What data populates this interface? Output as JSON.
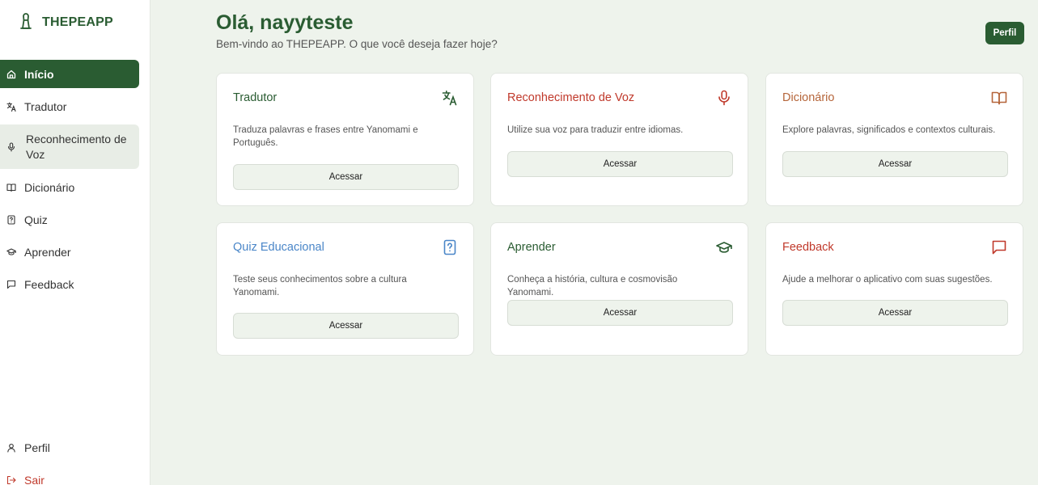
{
  "app": {
    "name": "THEPEAPP"
  },
  "sidebar": {
    "items": [
      {
        "label": "Início",
        "icon": "home-icon"
      },
      {
        "label": "Tradutor",
        "icon": "translate-icon"
      },
      {
        "label": "Reconhecimento de Voz",
        "icon": "mic-icon"
      },
      {
        "label": "Dicionário",
        "icon": "book-icon"
      },
      {
        "label": "Quiz",
        "icon": "quiz-icon"
      },
      {
        "label": "Aprender",
        "icon": "graduation-cap-icon"
      },
      {
        "label": "Feedback",
        "icon": "message-icon"
      }
    ],
    "bottom": [
      {
        "label": "Perfil",
        "icon": "user-icon"
      },
      {
        "label": "Sair",
        "icon": "logout-icon"
      }
    ]
  },
  "header": {
    "title": "Olá, nayyteste",
    "subtitle": "Bem-vindo ao THEPEAPP. O que você deseja fazer hoje?",
    "profile_button": "Perfil"
  },
  "cards": [
    {
      "title": "Tradutor",
      "description": "Traduza palavras e frases entre Yanomami e Português.",
      "button": "Acessar",
      "icon": "translate-icon",
      "color": "#2a5c32"
    },
    {
      "title": "Reconhecimento de Voz",
      "description": "Utilize sua voz para traduzir entre idiomas.",
      "button": "Acessar",
      "icon": "mic-icon",
      "color": "#c0392b"
    },
    {
      "title": "Dicionário",
      "description": "Explore palavras, significados e contextos culturais.",
      "button": "Acessar",
      "icon": "book-icon",
      "color": "#b5653a"
    },
    {
      "title": "Quiz Educacional",
      "description": "Teste seus conhecimentos sobre a cultura Yanomami.",
      "button": "Acessar",
      "icon": "quiz-icon",
      "color": "#4a86c8"
    },
    {
      "title": "Aprender",
      "description": "Conheça a história, cultura e cosmovisão Yanomami.",
      "button": "Acessar",
      "icon": "graduation-cap-icon",
      "color": "#2a5c32"
    },
    {
      "title": "Feedback",
      "description": "Ajude a melhorar o aplicativo com suas sugestões.",
      "button": "Acessar",
      "icon": "message-icon",
      "color": "#c0392b"
    }
  ]
}
